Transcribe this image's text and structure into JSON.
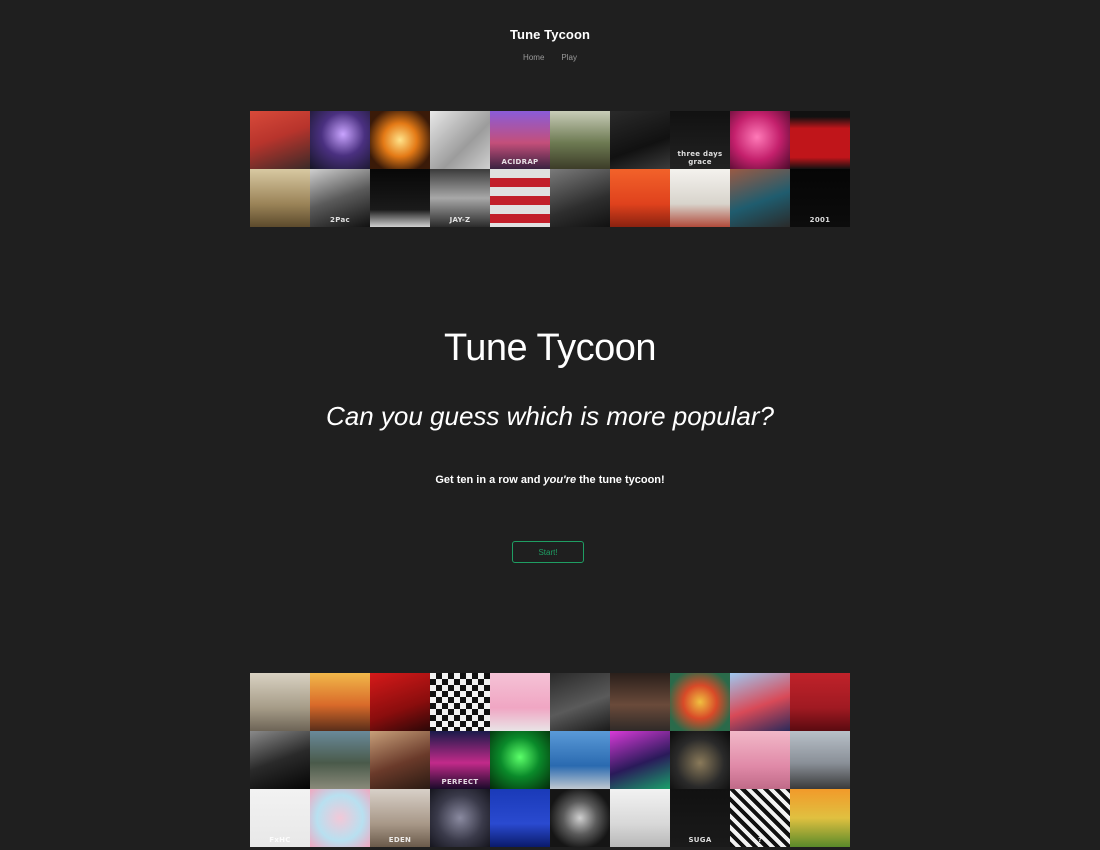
{
  "header": {
    "title": "Tune Tycoon",
    "nav": [
      {
        "label": "Home"
      },
      {
        "label": "Play"
      }
    ]
  },
  "hero": {
    "title": "Tune Tycoon",
    "tagline": "Can you guess which is more popular?",
    "instruction_before": "Get ten in a row and ",
    "instruction_emphasis": "you're",
    "instruction_after": " the tune tycoon!",
    "start_label": "Start!"
  },
  "colors": {
    "background": "#1f1f1f",
    "accent": "#1f9e63",
    "nav_text": "#9a9a9a"
  },
  "top_covers": [
    {
      "name": "cover-childish-gambino",
      "bg": "linear-gradient(160deg,#d84a3a,#b8342c 45%,#3a2a28)"
    },
    {
      "name": "cover-purple-figure",
      "bg": "radial-gradient(circle at 55% 40%,#c9a4ff,#4a3080 45%,#151525)"
    },
    {
      "name": "cover-fire-explosion",
      "bg": "radial-gradient(circle at 50% 50%,#ffe38a,#e47a16 40%,#3a1a08 80%)"
    },
    {
      "name": "cover-reputation",
      "bg": "linear-gradient(135deg,#e8e8e8,#9c9c9c 60%,#d0d0d0)"
    },
    {
      "name": "cover-acid-rap",
      "bg": "linear-gradient(180deg,#8a5cd8,#c44f7a 55%,#3a2140)",
      "text": "ACIDRAP"
    },
    {
      "name": "cover-outdoor-photo",
      "bg": "linear-gradient(180deg,#c8ccb8,#6d7a52 55%,#3c3c28)"
    },
    {
      "name": "cover-dark-white-text",
      "bg": "linear-gradient(160deg,#2a2a2a,#111 60%,#3c3c3c)"
    },
    {
      "name": "cover-twenty-one-pilots",
      "bg": "linear-gradient(180deg,#111,#222)",
      "text": "three days grace"
    },
    {
      "name": "cover-rihanna-pink",
      "bg": "radial-gradient(circle at 45% 45%,#ff7ab8,#c4206c 50%,#4a0a2a)"
    },
    {
      "name": "cover-red-framed",
      "bg": "linear-gradient(180deg,#111 10%,#c0151a 30%,#c0151a 80%,#111)"
    },
    {
      "name": "cover-sepia-photo",
      "bg": "linear-gradient(180deg,#d8c9a2,#9b8458 60%,#5c4a2c)"
    },
    {
      "name": "cover-2pac",
      "bg": "linear-gradient(160deg,#cfcfcf,#5a5a5a 50%,#111)",
      "text": "2Pac"
    },
    {
      "name": "cover-billie-eilish",
      "bg": "linear-gradient(180deg,#070707,#1a1a1a 70%,#d0d0d0)"
    },
    {
      "name": "cover-jay-z",
      "bg": "linear-gradient(180deg,#3b3b3b,#a8a8a8 50%,#2b2b2b)",
      "text": "JAY-Z"
    },
    {
      "name": "cover-stripes-figure",
      "bg": "repeating-linear-gradient(180deg,#e0e0e0 0 9px,#c21f2a 9px 18px)"
    },
    {
      "name": "cover-drake-portrait",
      "bg": "linear-gradient(160deg,#7a7a7a,#2e2e2e 60%,#111)"
    },
    {
      "name": "cover-orange-sunset",
      "bg": "linear-gradient(180deg,#f2622a,#e0421d 60%,#8a2210)"
    },
    {
      "name": "cover-white-figure",
      "bg": "linear-gradient(180deg,#f4f2ee,#d8d4cc 60%,#b04a3a)"
    },
    {
      "name": "cover-teal-sweater",
      "bg": "linear-gradient(160deg,#9a5a44,#1f5c6e 55%,#2a2a2a)"
    },
    {
      "name": "cover-dr-dre-2001",
      "bg": "linear-gradient(180deg,#050505,#0c0c0c)",
      "text": "2001"
    }
  ],
  "bottom_covers": [
    {
      "name": "cover-beige-portrait",
      "bg": "linear-gradient(180deg,#d9d2c2,#a69c88 60%,#6d6456)"
    },
    {
      "name": "cover-astroworld",
      "bg": "linear-gradient(180deg,#f2b84a,#d96a2a 55%,#5a2e1a)"
    },
    {
      "name": "cover-red-pose",
      "bg": "linear-gradient(160deg,#d61a1a,#8a0d0d 60%,#2b0707)"
    },
    {
      "name": "cover-checkered",
      "bg": "repeating-conic-gradient(#111 0 25%,#f2f2f2 0 50%) 0 0/12px 12px"
    },
    {
      "name": "cover-pink-pastel",
      "bg": "linear-gradient(180deg,#f5c2d6,#f0a6c3 60%,#e9e4e6)"
    },
    {
      "name": "cover-duo-standing",
      "bg": "linear-gradient(160deg,#2a2a2a,#5a5a5a 55%,#1a1a1a)"
    },
    {
      "name": "cover-city-building",
      "bg": "linear-gradient(180deg,#2a1f1a,#6a4a3a 55%,#2f2a28)"
    },
    {
      "name": "cover-colorful-art",
      "bg": "radial-gradient(circle at 50% 50%,#f0c040,#d84a28 40%,#2a6a4a 80%)"
    },
    {
      "name": "cover-lil-uzi",
      "bg": "linear-gradient(160deg,#9ec8f0,#d84a58 55%,#2a2a5a)"
    },
    {
      "name": "cover-red-lake",
      "bg": "linear-gradient(180deg,#c0222a,#a01a22 60%,#5a0a10)"
    },
    {
      "name": "cover-bw-portrait",
      "bg": "linear-gradient(160deg,#8a8a8a,#2a2a2a 50%,#050505)"
    },
    {
      "name": "cover-abbey-road",
      "bg": "linear-gradient(180deg,#6a8a9a,#4a5a4a 55%,#8a8a7a)"
    },
    {
      "name": "cover-vintage-illustration",
      "bg": "linear-gradient(160deg,#c8a07a,#6a3a2a 55%,#2a1a12)"
    },
    {
      "name": "cover-perfect-timing",
      "bg": "linear-gradient(180deg,#1a1a4a,#c22a8a 55%,#1a0a2a)",
      "text": "PERFECT"
    },
    {
      "name": "cover-green-face",
      "bg": "radial-gradient(circle at 50% 45%,#5cff6a,#0a8a2a 45%,#052a0a)"
    },
    {
      "name": "cover-blue-sky",
      "bg": "linear-gradient(180deg,#5a9ad8,#2a6ab0 60%,#c0c8d0)"
    },
    {
      "name": "cover-neon-car",
      "bg": "linear-gradient(160deg,#d83ad8,#2a1a5a 55%,#1aa06a)"
    },
    {
      "name": "cover-dark-sculpture",
      "bg": "radial-gradient(circle at 50% 55%,#8a7a5a,#2a2a2a 55%,#0a0a0a)"
    },
    {
      "name": "cover-pink-face",
      "bg": "linear-gradient(180deg,#f2b8c8,#e08aa8 60%,#c06a88)"
    },
    {
      "name": "cover-road-landscape",
      "bg": "linear-gradient(180deg,#b8c0c8,#8a9098 55%,#3a3a3a)"
    },
    {
      "name": "cover-fxhc",
      "bg": "linear-gradient(180deg,#f2f2f2,#e8e8e8)",
      "text": "FxHC"
    },
    {
      "name": "cover-pastel-circle",
      "bg": "radial-gradient(circle at 50% 50%,#f2c8d8,#b8e0f0 55%,#f0a8c0)"
    },
    {
      "name": "cover-eden",
      "bg": "linear-gradient(180deg,#d8d0c8,#a89888 60%,#6a5a4a)",
      "text": "EDEN"
    },
    {
      "name": "cover-ornate-dark",
      "bg": "radial-gradient(circle at 50% 50%,#8a8aa0,#3a3a4a 55%,#15151e)"
    },
    {
      "name": "cover-rolling-stones",
      "bg": "linear-gradient(180deg,#1a3ab8,#2a4ad0 60%,#0a1a6a)"
    },
    {
      "name": "cover-collage",
      "bg": "radial-gradient(circle at 50% 50%,#d0d0d0,#5a5a5a 40%,#151515 75%)"
    },
    {
      "name": "cover-mac-miller",
      "bg": "linear-gradient(180deg,#f2f2f2,#d8d8d8 60%,#b8b8b8)"
    },
    {
      "name": "cover-suga",
      "bg": "linear-gradient(180deg,#111,#1a1a1a)",
      "text": "SUGA"
    },
    {
      "name": "cover-question-mark",
      "bg": "repeating-linear-gradient(45deg,#111 0 4px,#f2f2f2 4px 8px)",
      "text": "?"
    },
    {
      "name": "cover-flower-boy",
      "bg": "linear-gradient(180deg,#f29a2a,#e0c040 50%,#5a8a2a)"
    }
  ]
}
